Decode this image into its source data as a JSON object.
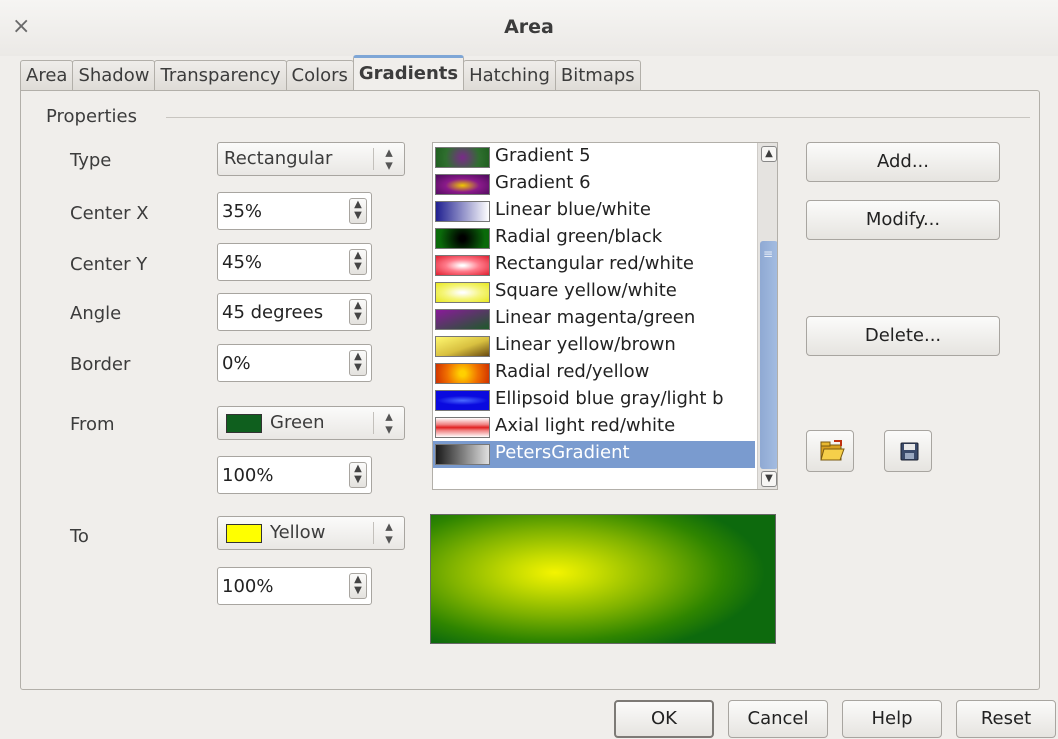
{
  "window": {
    "title": "Area",
    "close_glyph": "×"
  },
  "tabs": [
    {
      "label": "Area",
      "active": false
    },
    {
      "label": "Shadow",
      "active": false
    },
    {
      "label": "Transparency",
      "active": false
    },
    {
      "label": "Colors",
      "active": false
    },
    {
      "label": "Gradients",
      "active": true
    },
    {
      "label": "Hatching",
      "active": false
    },
    {
      "label": "Bitmaps",
      "active": false
    }
  ],
  "properties": {
    "title": "Properties",
    "type": {
      "label": "Type",
      "value": "Rectangular"
    },
    "center_x": {
      "label": "Center X",
      "value": "35%"
    },
    "center_y": {
      "label": "Center Y",
      "value": "45%"
    },
    "angle": {
      "label": "Angle",
      "value": "45 degrees"
    },
    "border": {
      "label": "Border",
      "value": "0%"
    },
    "from": {
      "label": "From",
      "color_name": "Green",
      "color": "#0f5f1e",
      "intensity": "100%"
    },
    "to": {
      "label": "To",
      "color_name": "Yellow",
      "color": "#ffff00",
      "intensity": "100%"
    }
  },
  "gradient_list": {
    "items": [
      {
        "label": "Gradient 5",
        "selected": false
      },
      {
        "label": "Gradient 6",
        "selected": false
      },
      {
        "label": "Linear blue/white",
        "selected": false
      },
      {
        "label": "Radial green/black",
        "selected": false
      },
      {
        "label": "Rectangular red/white",
        "selected": false
      },
      {
        "label": "Square yellow/white",
        "selected": false
      },
      {
        "label": "Linear magenta/green",
        "selected": false
      },
      {
        "label": "Linear yellow/brown",
        "selected": false
      },
      {
        "label": "Radial red/yellow",
        "selected": false
      },
      {
        "label": "Ellipsoid blue gray/light b",
        "selected": false
      },
      {
        "label": "Axial light red/white",
        "selected": false
      },
      {
        "label": "PetersGradient",
        "selected": true
      }
    ]
  },
  "buttons": {
    "add": "Add...",
    "modify": "Modify...",
    "delete": "Delete...",
    "load_icon": "folder-open-icon",
    "save_icon": "floppy-save-icon"
  },
  "footer": {
    "ok": "OK",
    "cancel": "Cancel",
    "help": "Help",
    "reset": "Reset"
  }
}
